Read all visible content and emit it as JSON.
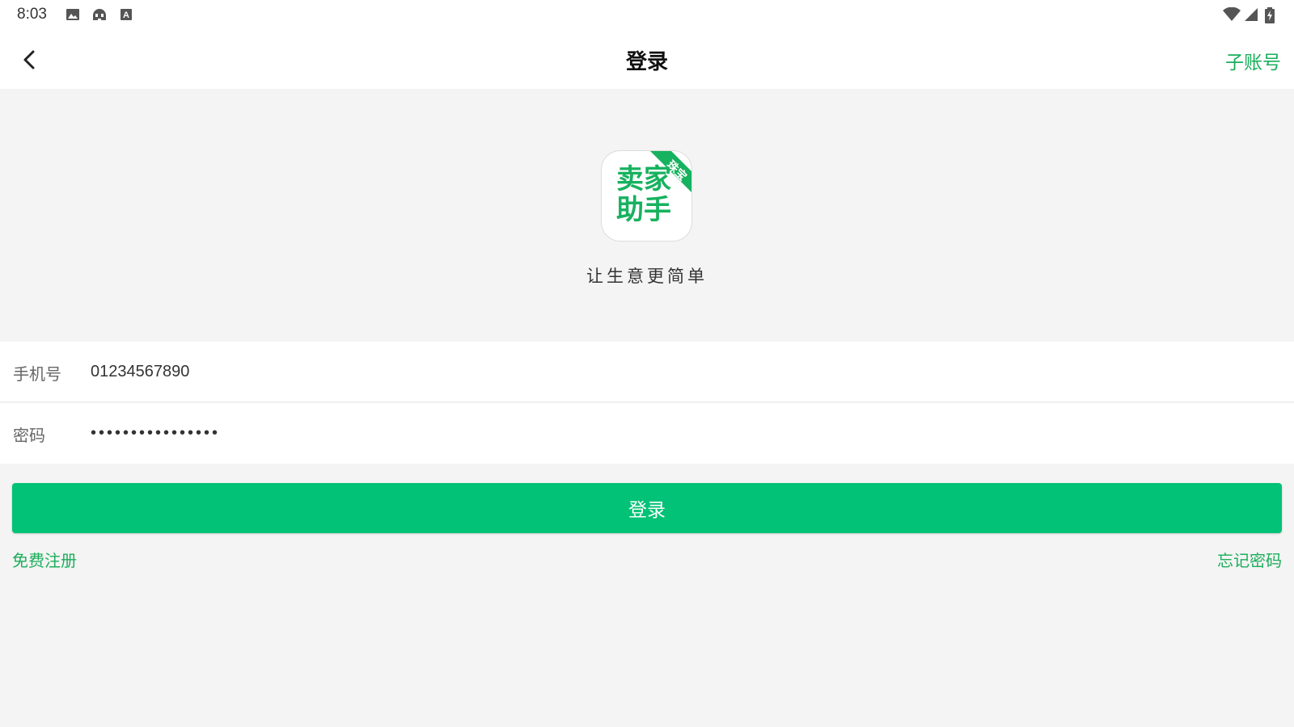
{
  "status_bar": {
    "time": "8:03",
    "left_icons": [
      "image-icon",
      "android-robot-icon",
      "font-a-icon"
    ],
    "right_icons": [
      "wifi-icon",
      "cell-signal-icon",
      "battery-charging-icon"
    ]
  },
  "app_bar": {
    "title": "登录",
    "right_action": "子账号",
    "back_icon": "chevron-left-icon"
  },
  "logo": {
    "text_line1": "卖家",
    "text_line2": "助手",
    "badge": "珠宝",
    "brand_color": "#17b25f"
  },
  "slogan": "让生意更简单",
  "form": {
    "phone_label": "手机号",
    "phone_value": "01234567890",
    "password_label": "密码",
    "password_value": "••••••••••••••••"
  },
  "buttons": {
    "login": "登录"
  },
  "links": {
    "register": "免费注册",
    "forgot_password": "忘记密码"
  },
  "colors": {
    "accent": "#1aae5a",
    "button": "#01c276",
    "background": "#f4f4f4"
  }
}
